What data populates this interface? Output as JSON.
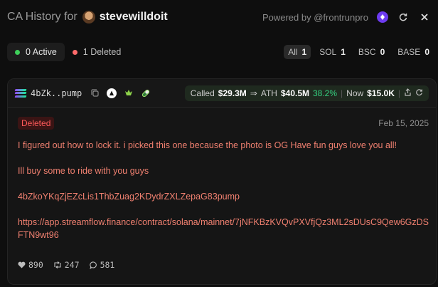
{
  "header": {
    "title_prefix": "CA History for",
    "username": "stevewilldoit",
    "powered_by": "Powered by @frontrunpro"
  },
  "tabs": [
    {
      "label": "0 Active",
      "dot_color": "#3ecf5a"
    },
    {
      "label": "1 Deleted",
      "dot_color": "#ff6b6b"
    }
  ],
  "filters": [
    {
      "label": "All",
      "count": "1"
    },
    {
      "label": "SOL",
      "count": "1"
    },
    {
      "label": "BSC",
      "count": "0"
    },
    {
      "label": "BASE",
      "count": "0"
    }
  ],
  "card": {
    "address_short": "4bZk..pump",
    "called_label": "Called",
    "called_value": "$29.3M",
    "arrow": "⇒",
    "ath_label": "ATH",
    "ath_value": "$40.5M",
    "ath_pct": "38.2%",
    "now_label": "Now",
    "now_value": "$15.0K",
    "status": "Deleted",
    "date": "Feb 15, 2025",
    "lines": [
      "I figured out how to lock it. i picked this one because the photo is OG Have fun guys love you all!",
      "Ill buy some to ride with you guys",
      "4bZkoYKqZjEZcLis1ThbZuag2KDydrZXLZepaG83pump",
      "https://app.streamflow.finance/contract/solana/mainnet/7jNFKBzKVQvPXVfjQz3ML2sDUsC9Qew6GzDSFTN9wt96"
    ],
    "likes": "890",
    "retweets": "247",
    "replies": "581"
  }
}
